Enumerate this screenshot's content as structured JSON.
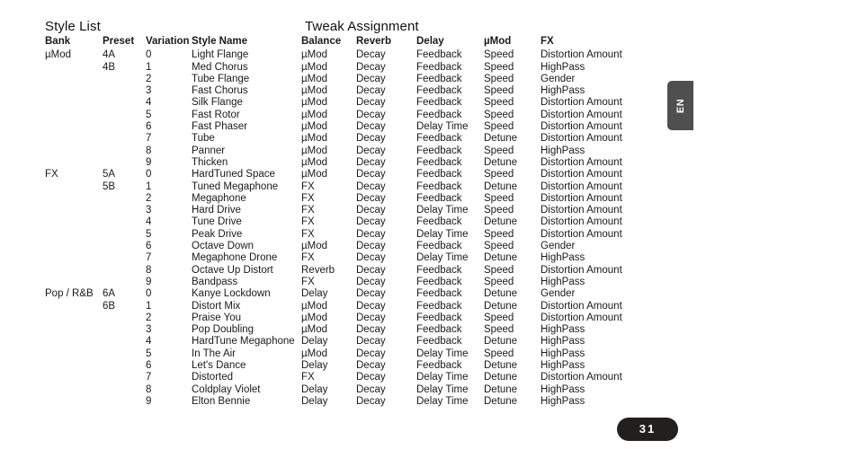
{
  "sections": {
    "style_list_title": "Style List",
    "tweak_title": "Tweak Assignment"
  },
  "headers": {
    "bank": "Bank",
    "preset": "Preset",
    "variation": "Variation",
    "style_name": "Style Name",
    "balance": "Balance",
    "reverb": "Reverb",
    "delay": "Delay",
    "umod": "µMod",
    "fx": "FX"
  },
  "rows": [
    {
      "bank": "µMod",
      "preset": "4A",
      "variation": "0",
      "style_name": "Light Flange",
      "balance": "µMod",
      "reverb": "Decay",
      "delay": "Feedback",
      "umod": "Speed",
      "fx": "Distortion Amount"
    },
    {
      "bank": "",
      "preset": "4B",
      "variation": "1",
      "style_name": "Med Chorus",
      "balance": "µMod",
      "reverb": "Decay",
      "delay": "Feedback",
      "umod": "Speed",
      "fx": "HighPass"
    },
    {
      "bank": "",
      "preset": "",
      "variation": "2",
      "style_name": "Tube Flange",
      "balance": "µMod",
      "reverb": "Decay",
      "delay": "Feedback",
      "umod": "Speed",
      "fx": "Gender"
    },
    {
      "bank": "",
      "preset": "",
      "variation": "3",
      "style_name": "Fast Chorus",
      "balance": "µMod",
      "reverb": "Decay",
      "delay": "Feedback",
      "umod": "Speed",
      "fx": "HighPass"
    },
    {
      "bank": "",
      "preset": "",
      "variation": "4",
      "style_name": "Silk Flange",
      "balance": "µMod",
      "reverb": "Decay",
      "delay": "Feedback",
      "umod": "Speed",
      "fx": "Distortion Amount"
    },
    {
      "bank": "",
      "preset": "",
      "variation": "5",
      "style_name": "Fast Rotor",
      "balance": "µMod",
      "reverb": "Decay",
      "delay": "Feedback",
      "umod": "Speed",
      "fx": "Distortion Amount"
    },
    {
      "bank": "",
      "preset": "",
      "variation": "6",
      "style_name": "Fast Phaser",
      "balance": "µMod",
      "reverb": "Decay",
      "delay": "Delay Time",
      "umod": "Speed",
      "fx": "Distortion Amount"
    },
    {
      "bank": "",
      "preset": "",
      "variation": "7",
      "style_name": "Tube",
      "balance": "µMod",
      "reverb": "Decay",
      "delay": "Feedback",
      "umod": "Detune",
      "fx": "Distortion Amount"
    },
    {
      "bank": "",
      "preset": "",
      "variation": "8",
      "style_name": "Panner",
      "balance": "µMod",
      "reverb": "Decay",
      "delay": "Feedback",
      "umod": "Speed",
      "fx": "HighPass"
    },
    {
      "bank": "",
      "preset": "",
      "variation": "9",
      "style_name": "Thicken",
      "balance": "µMod",
      "reverb": "Decay",
      "delay": "Feedback",
      "umod": "Detune",
      "fx": "Distortion Amount"
    },
    {
      "bank": "FX",
      "preset": "5A",
      "variation": "0",
      "style_name": "HardTuned Space",
      "balance": "µMod",
      "reverb": "Decay",
      "delay": "Feedback",
      "umod": "Speed",
      "fx": "Distortion Amount"
    },
    {
      "bank": "",
      "preset": "5B",
      "variation": "1",
      "style_name": "Tuned Megaphone",
      "balance": "FX",
      "reverb": "Decay",
      "delay": "Feedback",
      "umod": "Detune",
      "fx": "Distortion Amount"
    },
    {
      "bank": "",
      "preset": "",
      "variation": "2",
      "style_name": "Megaphone",
      "balance": "FX",
      "reverb": "Decay",
      "delay": "Feedback",
      "umod": "Speed",
      "fx": "Distortion Amount"
    },
    {
      "bank": "",
      "preset": "",
      "variation": "3",
      "style_name": "Hard Drive",
      "balance": "FX",
      "reverb": "Decay",
      "delay": "Delay Time",
      "umod": "Speed",
      "fx": "Distortion Amount"
    },
    {
      "bank": "",
      "preset": "",
      "variation": "4",
      "style_name": "Tune Drive",
      "balance": "FX",
      "reverb": "Decay",
      "delay": "Feedback",
      "umod": "Detune",
      "fx": "Distortion Amount"
    },
    {
      "bank": "",
      "preset": "",
      "variation": "5",
      "style_name": "Peak Drive",
      "balance": "FX",
      "reverb": "Decay",
      "delay": "Delay Time",
      "umod": "Speed",
      "fx": "Distortion Amount"
    },
    {
      "bank": "",
      "preset": "",
      "variation": "6",
      "style_name": "Octave Down",
      "balance": "µMod",
      "reverb": "Decay",
      "delay": "Feedback",
      "umod": "Speed",
      "fx": "Gender"
    },
    {
      "bank": "",
      "preset": "",
      "variation": "7",
      "style_name": "Megaphone Drone",
      "balance": "FX",
      "reverb": "Decay",
      "delay": "Delay Time",
      "umod": "Detune",
      "fx": "HighPass"
    },
    {
      "bank": "",
      "preset": "",
      "variation": "8",
      "style_name": "Octave Up Distort",
      "balance": "Reverb",
      "reverb": "Decay",
      "delay": "Feedback",
      "umod": "Speed",
      "fx": "Distortion Amount"
    },
    {
      "bank": "",
      "preset": "",
      "variation": "9",
      "style_name": "Bandpass",
      "balance": "FX",
      "reverb": "Decay",
      "delay": "Feedback",
      "umod": "Speed",
      "fx": "HighPass"
    },
    {
      "bank": "Pop / R&B",
      "preset": "6A",
      "variation": "0",
      "style_name": "Kanye Lockdown",
      "balance": "Delay",
      "reverb": "Decay",
      "delay": "Feedback",
      "umod": "Detune",
      "fx": "Gender"
    },
    {
      "bank": "",
      "preset": "6B",
      "variation": "1",
      "style_name": "Distort Mix",
      "balance": "µMod",
      "reverb": "Decay",
      "delay": "Feedback",
      "umod": "Detune",
      "fx": "Distortion Amount"
    },
    {
      "bank": "",
      "preset": "",
      "variation": "2",
      "style_name": "Praise You",
      "balance": "µMod",
      "reverb": "Decay",
      "delay": "Feedback",
      "umod": "Speed",
      "fx": "Distortion Amount"
    },
    {
      "bank": "",
      "preset": "",
      "variation": "3",
      "style_name": "Pop Doubling",
      "balance": "µMod",
      "reverb": "Decay",
      "delay": "Feedback",
      "umod": "Speed",
      "fx": "HighPass"
    },
    {
      "bank": "",
      "preset": "",
      "variation": "4",
      "style_name": "HardTune Megaphone",
      "balance": "Delay",
      "reverb": "Decay",
      "delay": "Feedback",
      "umod": "Detune",
      "fx": "HighPass"
    },
    {
      "bank": "",
      "preset": "",
      "variation": "5",
      "style_name": "In The Air",
      "balance": "µMod",
      "reverb": "Decay",
      "delay": "Delay Time",
      "umod": "Speed",
      "fx": "HighPass"
    },
    {
      "bank": "",
      "preset": "",
      "variation": "6",
      "style_name": "Let's Dance",
      "balance": "Delay",
      "reverb": "Decay",
      "delay": "Feedback",
      "umod": "Detune",
      "fx": "HighPass"
    },
    {
      "bank": "",
      "preset": "",
      "variation": "7",
      "style_name": "Distorted",
      "balance": "FX",
      "reverb": "Decay",
      "delay": "Delay Time",
      "umod": "Detune",
      "fx": "Distortion Amount"
    },
    {
      "bank": "",
      "preset": "",
      "variation": "8",
      "style_name": "Coldplay Violet",
      "balance": "Delay",
      "reverb": "Decay",
      "delay": "Delay Time",
      "umod": "Detune",
      "fx": "HighPass"
    },
    {
      "bank": "",
      "preset": "",
      "variation": "9",
      "style_name": "Elton Bennie",
      "balance": "Delay",
      "reverb": "Decay",
      "delay": "Delay Time",
      "umod": "Detune",
      "fx": "HighPass"
    }
  ],
  "language_tab": {
    "label": "EN"
  },
  "page_number": {
    "label": "31"
  },
  "colors": {
    "text": "#1a1a1a",
    "lang_tab_bg": "#4f4f4f",
    "page_badge_bg": "#231f1f",
    "page_badge_text": "#ffffff"
  }
}
